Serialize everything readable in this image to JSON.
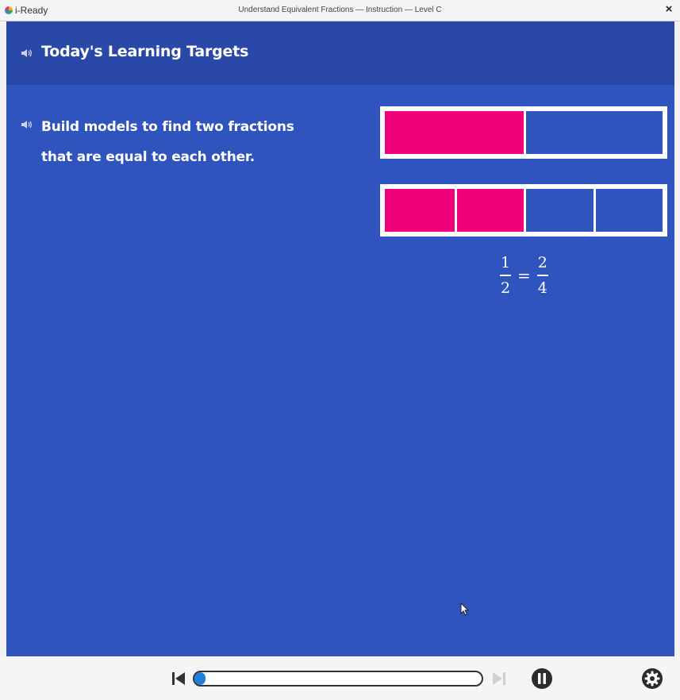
{
  "window": {
    "logo_text": "i-Ready",
    "title": "Understand Equivalent Fractions — Instruction — Level C",
    "close_label": "×"
  },
  "header": {
    "title": "Today's Learning Targets",
    "speaker_icon": "speaker-icon"
  },
  "target": {
    "line1": "Build models to find two fractions",
    "line2": "that are equal to each other.",
    "speaker_icon": "speaker-icon"
  },
  "models": {
    "colors": {
      "filled": "#f0007a",
      "empty": "#2f54bd",
      "border": "#ffffff"
    },
    "bars": [
      {
        "parts": 2,
        "filled": 1
      },
      {
        "parts": 4,
        "filled": 2
      }
    ]
  },
  "equation": {
    "left": {
      "numerator": "1",
      "denominator": "2"
    },
    "operator": "=",
    "right": {
      "numerator": "2",
      "denominator": "4"
    }
  },
  "controls": {
    "progress_fraction": 0.04,
    "back_icon": "skip-back-icon",
    "forward_icon": "skip-forward-icon",
    "pause_icon": "pause-icon",
    "settings_icon": "gear-icon",
    "accent": "#1f7fe0"
  }
}
